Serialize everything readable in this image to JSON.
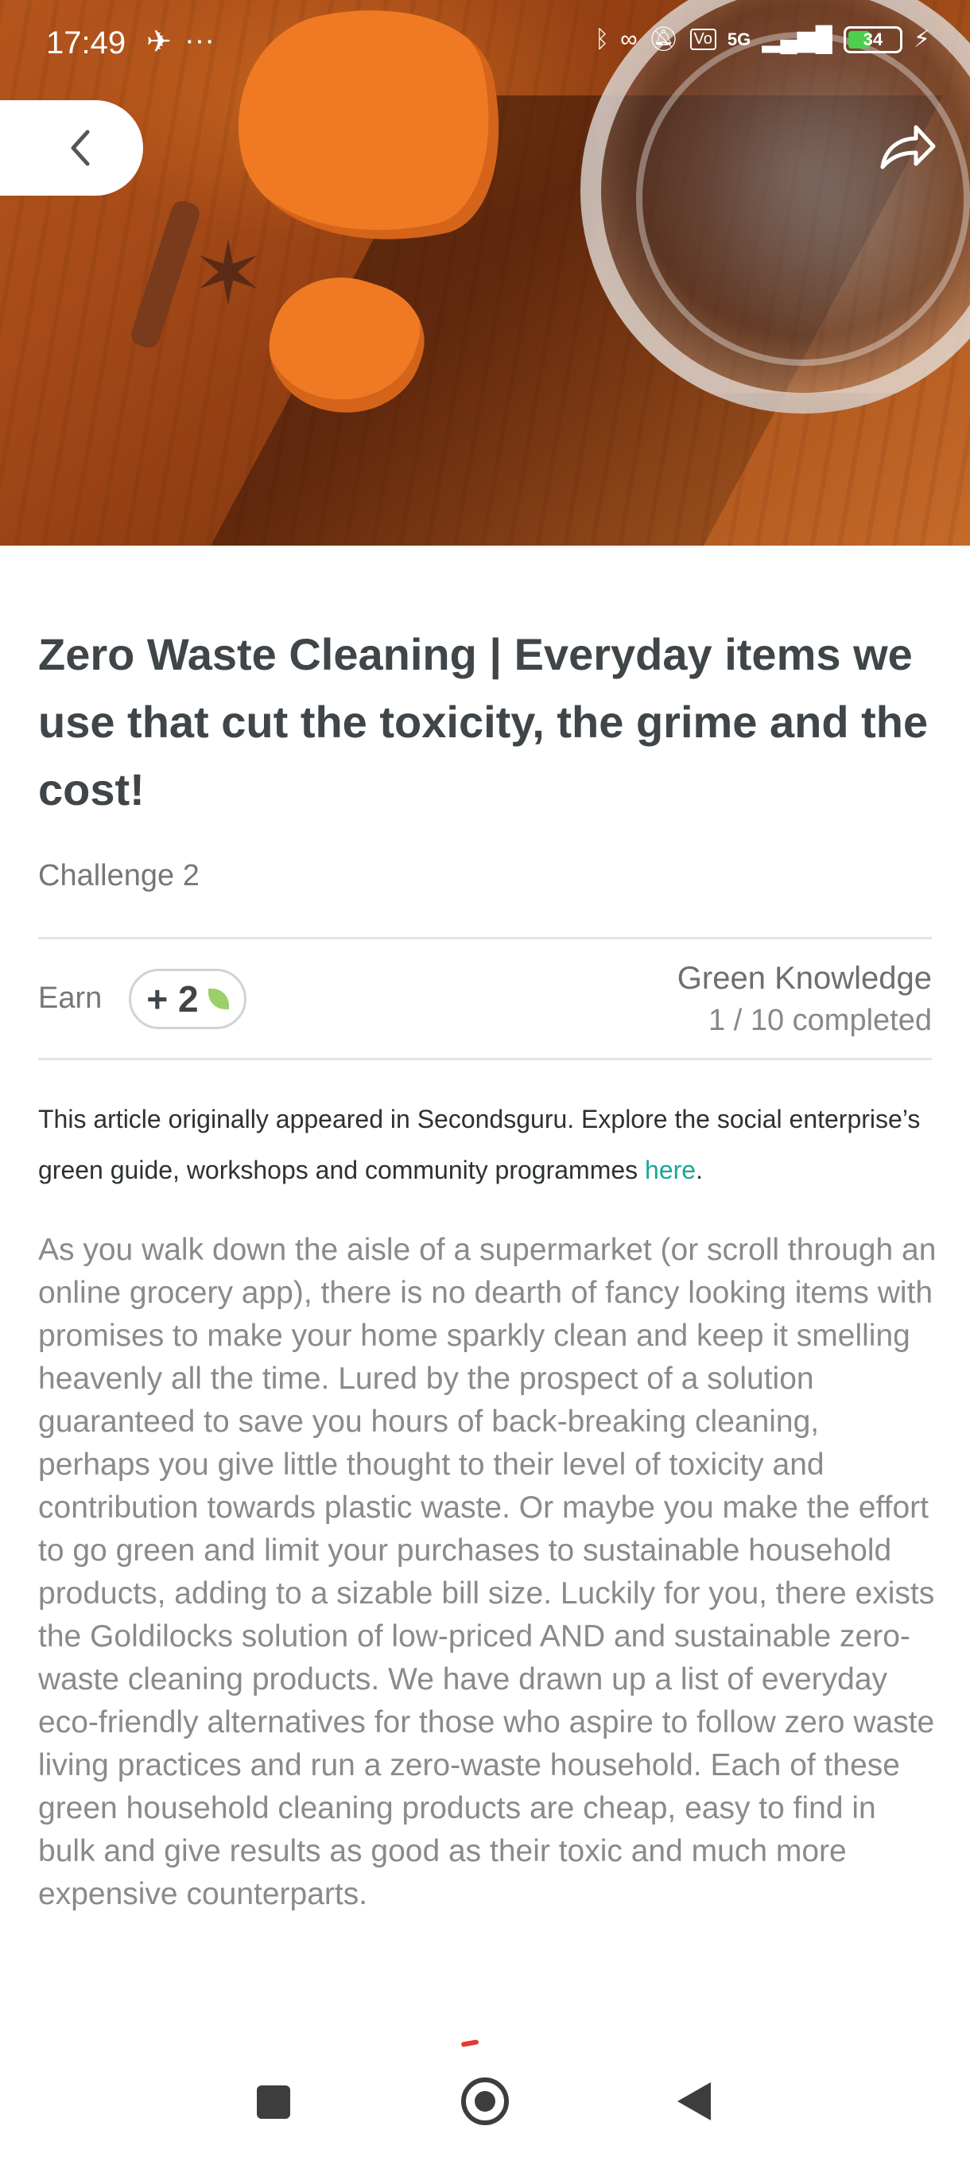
{
  "status_bar": {
    "time": "17:49",
    "network": "5G",
    "battery_level": "34"
  },
  "header": {
    "back_icon": "chevron-left-icon",
    "share_icon": "share-arrow-icon"
  },
  "article": {
    "title": "Zero Waste Cleaning | Everyday items we use that cut the toxicity, the grime and the cost!",
    "challenge": "Challenge 2",
    "earn_label": "Earn",
    "earn_points": "+ 2",
    "category": "Green Knowledge",
    "progress_text": "1 / 10 completed",
    "intro_text": "This article originally appeared in Secondsguru. Explore the social enterprise’s green guide, workshops and community programmes ",
    "intro_link": "here",
    "intro_end": ".",
    "body": "As you walk down the aisle of a supermarket (or scroll through an online grocery app), there is no dearth of fancy looking items with promises to make your home sparkly clean and keep it smelling heavenly all the time. Lured by the prospect of a solution guaranteed to save you hours of back-breaking cleaning, perhaps you give little thought to their level of toxicity and contribution towards plastic waste. Or maybe you make the effort to go green and limit your purchases to sustainable household products, adding to a sizable bill size. Luckily for you, there exists the Goldilocks solution of low-priced AND and sustainable zero-waste cleaning products. We have drawn up a list of everyday eco-friendly alternatives for those who aspire to follow zero waste living practices and run a zero-waste household. Each of these green household cleaning products are cheap, easy to find in bulk and give results as good as their toxic and much more expensive counterparts."
  },
  "colors": {
    "title": "#3f4548",
    "link": "#1aa79a",
    "leaf": "#9bd06a"
  }
}
